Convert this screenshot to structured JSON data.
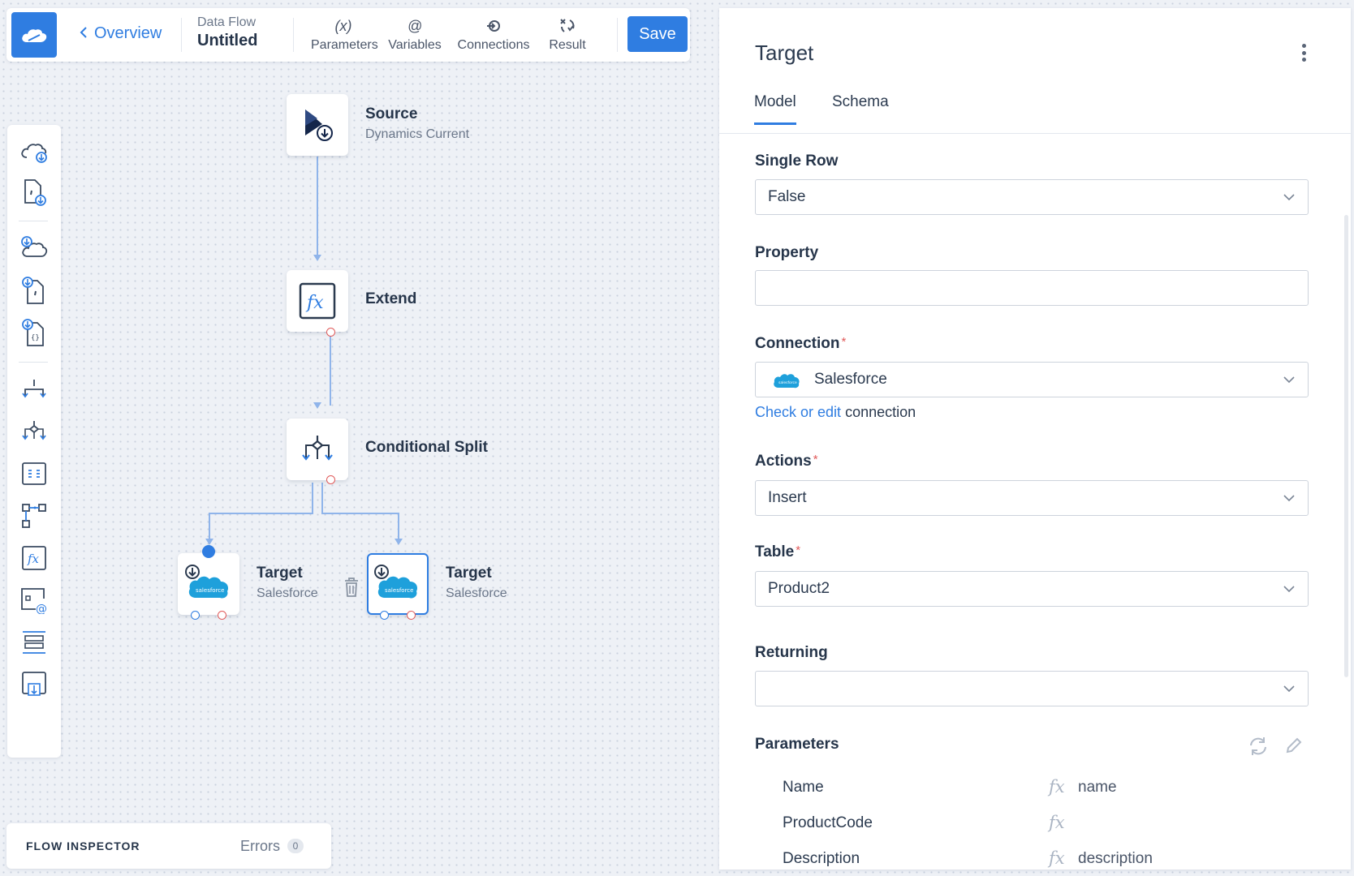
{
  "toolbar": {
    "back_label": "Overview",
    "breadcrumb_top": "Data Flow",
    "breadcrumb_title": "Untitled",
    "buttons": [
      {
        "label": "Parameters",
        "icon": "(x)"
      },
      {
        "label": "Variables",
        "icon": "@"
      },
      {
        "label": "Connections",
        "icon": "connections-icon"
      },
      {
        "label": "Result",
        "icon": "result-icon"
      }
    ],
    "save_label": "Save"
  },
  "canvas": {
    "nodes": [
      {
        "title": "Source",
        "subtitle": "Dynamics Current",
        "icon": "dynamics-icon"
      },
      {
        "title": "Extend",
        "subtitle": "",
        "icon": "fx-icon"
      },
      {
        "title": "Conditional Split",
        "subtitle": "",
        "icon": "split-icon"
      },
      {
        "title": "Target",
        "subtitle": "Salesforce",
        "icon": "salesforce-icon"
      },
      {
        "title": "Target",
        "subtitle": "Salesforce",
        "icon": "salesforce-icon"
      }
    ]
  },
  "inspector": {
    "title": "FLOW INSPECTOR",
    "errors_label": "Errors",
    "errors_count": "0"
  },
  "panel": {
    "title": "Target",
    "tabs": [
      "Model",
      "Schema"
    ],
    "active_tab": "Model",
    "fields": {
      "single_row": {
        "label": "Single Row",
        "value": "False"
      },
      "property": {
        "label": "Property",
        "value": ""
      },
      "connection": {
        "label": "Connection",
        "value": "Salesforce",
        "required": "*"
      },
      "connection_link": "Check or edit",
      "connection_link_suffix": "connection",
      "actions": {
        "label": "Actions",
        "value": "Insert",
        "required": "*"
      },
      "table": {
        "label": "Table",
        "value": "Product2",
        "required": "*"
      },
      "returning": {
        "label": "Returning",
        "value": ""
      }
    },
    "parameters": {
      "label": "Parameters",
      "fx_glyph": "fx",
      "rows": [
        {
          "name": "Name",
          "value": "name"
        },
        {
          "name": "ProductCode",
          "value": ""
        },
        {
          "name": "Description",
          "value": "description"
        }
      ]
    }
  },
  "colors": {
    "accent": "#2f7de1",
    "port_red": "#e05a5a",
    "salesforce": "#1ea0db"
  }
}
